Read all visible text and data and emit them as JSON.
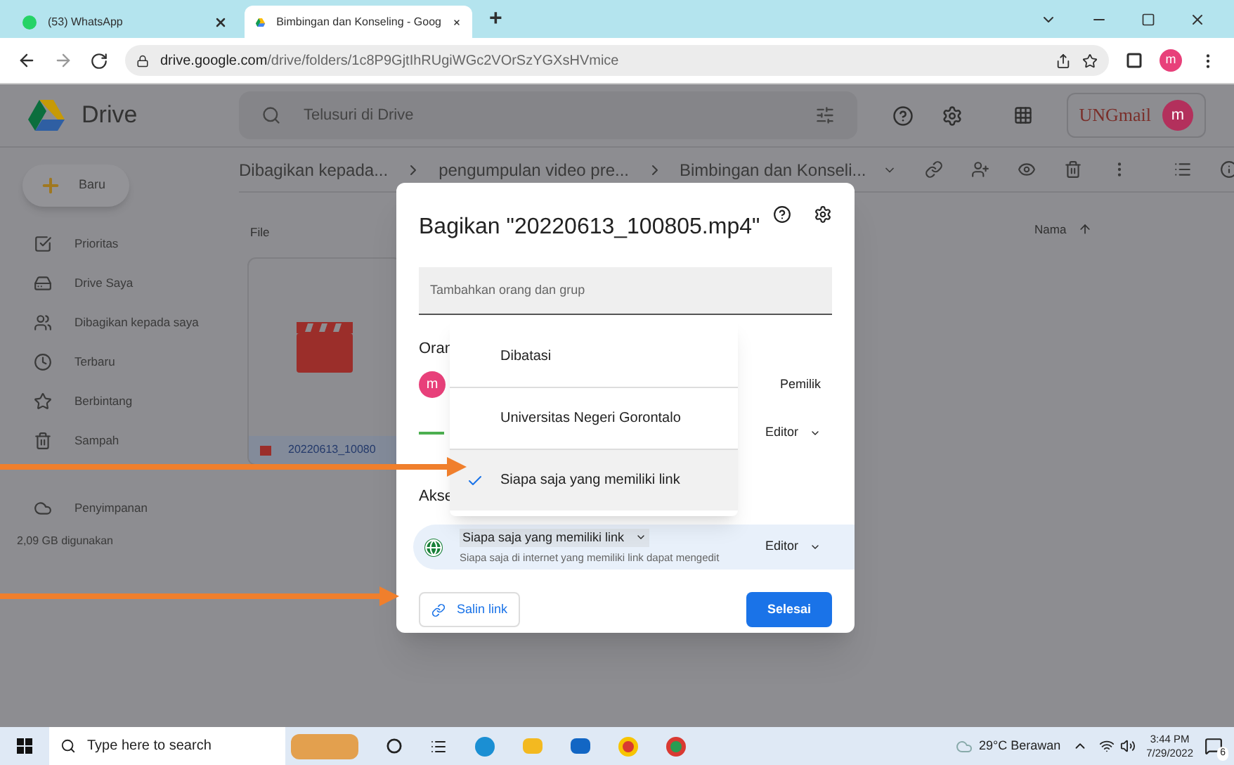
{
  "browser": {
    "tabs": [
      {
        "title": "(53) WhatsApp",
        "selected": false,
        "kind": "whatsapp"
      },
      {
        "title": "Bimbingan dan Konseling - Goog",
        "selected": true,
        "kind": "drive"
      }
    ],
    "new_tab": "+",
    "url": {
      "domain": "drive.google.com",
      "path": "/drive/folders/1c8P9GjtIhRUgiWGc2VOrSzYGXsHVmice"
    },
    "profile": "m"
  },
  "drive": {
    "logo": "Drive",
    "search_placeholder": "Telusuri di Drive",
    "brand": "UNGmail",
    "account": "m",
    "new_button": "Baru",
    "sidebar": [
      {
        "label": "Prioritas",
        "kind": "priority",
        "selected": false
      },
      {
        "label": "Drive Saya",
        "kind": "mydrive",
        "selected": false
      },
      {
        "label": "Dibagikan kepada saya",
        "kind": "shared",
        "selected": false
      },
      {
        "label": "Terbaru",
        "kind": "recent",
        "selected": false
      },
      {
        "label": "Berbintang",
        "kind": "starred",
        "selected": false
      },
      {
        "label": "Sampah",
        "kind": "trash",
        "selected": false
      },
      {
        "label": "Penyimpanan",
        "kind": "storage",
        "selected": false
      }
    ],
    "storage_used": "2,09 GB digunakan",
    "breadcrumbs": [
      "Dibagikan kepada...",
      "pengumpulan video pre...",
      "Bimbingan dan Konseli..."
    ],
    "files_label": "File",
    "sort_label": "Nama",
    "file_name": "20220613_10080"
  },
  "share_dialog": {
    "title": "Bagikan \"20220613_100805.mp4\"",
    "add_placeholder": "Tambahkan orang dan grup",
    "people_heading": "Oran",
    "people": [
      {
        "avatar": "m",
        "role": "Pemilik",
        "kind": "owner"
      },
      {
        "role": "Editor",
        "kind": "org"
      }
    ],
    "access_heading": "Akse",
    "access_option": "Siapa saja yang memiliki link",
    "access_description": "Siapa saja di internet yang memiliki link dapat mengedit",
    "access_role": "Editor",
    "copy_link": "Salin link",
    "done": "Selesai",
    "menu": [
      {
        "label": "Dibatasi",
        "selected": false
      },
      {
        "label": "Universitas Negeri Gorontalo",
        "selected": false
      },
      {
        "label": "Siapa saja yang memiliki link",
        "selected": true
      }
    ]
  },
  "taskbar": {
    "search_placeholder": "Type here to search",
    "weather": "29°C Berawan",
    "time": "3:44 PM",
    "date": "7/29/2022",
    "notifications": "6"
  }
}
